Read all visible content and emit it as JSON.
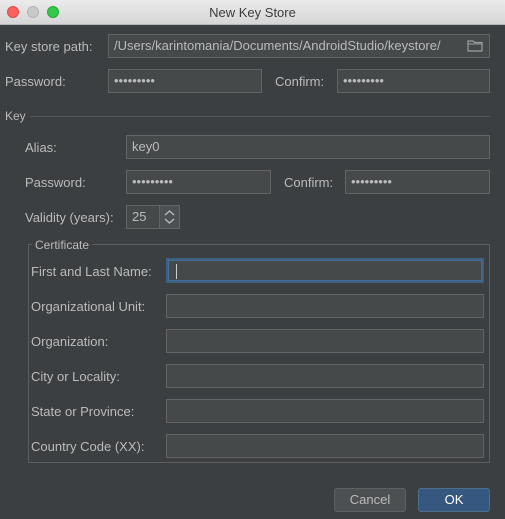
{
  "window": {
    "title": "New Key Store"
  },
  "keystore": {
    "path_label": "Key store path:",
    "path_value": "/Users/karintomania/Documents/AndroidStudio/keystore/",
    "password_label": "Password:",
    "password_value": "•••••••••",
    "confirm_label": "Confirm:",
    "confirm_value": "•••••••••"
  },
  "key": {
    "section_label": "Key",
    "alias_label": "Alias:",
    "alias_value": "key0",
    "password_label": "Password:",
    "password_value": "•••••••••",
    "confirm_label": "Confirm:",
    "confirm_value": "•••••••••",
    "validity_label": "Validity (years):",
    "validity_value": "25"
  },
  "certificate": {
    "section_label": "Certificate",
    "fields": [
      {
        "label": "First and Last Name:",
        "value": ""
      },
      {
        "label": "Organizational Unit:",
        "value": ""
      },
      {
        "label": "Organization:",
        "value": ""
      },
      {
        "label": "City or Locality:",
        "value": ""
      },
      {
        "label": "State or Province:",
        "value": ""
      },
      {
        "label": "Country Code (XX):",
        "value": ""
      }
    ]
  },
  "buttons": {
    "cancel": "Cancel",
    "ok": "OK"
  },
  "icons": {
    "folder": "folder-icon",
    "stepper": "stepper-arrows-icon"
  },
  "colors": {
    "background": "#3c3f41",
    "field": "#45494a",
    "ok_button": "#365880",
    "focus_border": "#3d6185"
  }
}
